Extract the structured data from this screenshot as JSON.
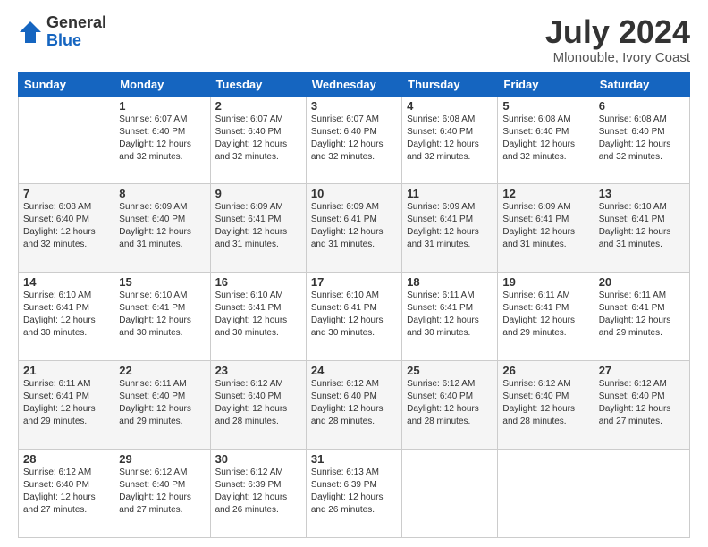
{
  "header": {
    "logo_general": "General",
    "logo_blue": "Blue",
    "title": "July 2024",
    "subtitle": "Mlonouble, Ivory Coast"
  },
  "days_of_week": [
    "Sunday",
    "Monday",
    "Tuesday",
    "Wednesday",
    "Thursday",
    "Friday",
    "Saturday"
  ],
  "weeks": [
    [
      {
        "day": "",
        "info": ""
      },
      {
        "day": "1",
        "info": "Sunrise: 6:07 AM\nSunset: 6:40 PM\nDaylight: 12 hours\nand 32 minutes."
      },
      {
        "day": "2",
        "info": "Sunrise: 6:07 AM\nSunset: 6:40 PM\nDaylight: 12 hours\nand 32 minutes."
      },
      {
        "day": "3",
        "info": "Sunrise: 6:07 AM\nSunset: 6:40 PM\nDaylight: 12 hours\nand 32 minutes."
      },
      {
        "day": "4",
        "info": "Sunrise: 6:08 AM\nSunset: 6:40 PM\nDaylight: 12 hours\nand 32 minutes."
      },
      {
        "day": "5",
        "info": "Sunrise: 6:08 AM\nSunset: 6:40 PM\nDaylight: 12 hours\nand 32 minutes."
      },
      {
        "day": "6",
        "info": "Sunrise: 6:08 AM\nSunset: 6:40 PM\nDaylight: 12 hours\nand 32 minutes."
      }
    ],
    [
      {
        "day": "7",
        "info": "Sunrise: 6:08 AM\nSunset: 6:40 PM\nDaylight: 12 hours\nand 32 minutes."
      },
      {
        "day": "8",
        "info": "Sunrise: 6:09 AM\nSunset: 6:40 PM\nDaylight: 12 hours\nand 31 minutes."
      },
      {
        "day": "9",
        "info": "Sunrise: 6:09 AM\nSunset: 6:41 PM\nDaylight: 12 hours\nand 31 minutes."
      },
      {
        "day": "10",
        "info": "Sunrise: 6:09 AM\nSunset: 6:41 PM\nDaylight: 12 hours\nand 31 minutes."
      },
      {
        "day": "11",
        "info": "Sunrise: 6:09 AM\nSunset: 6:41 PM\nDaylight: 12 hours\nand 31 minutes."
      },
      {
        "day": "12",
        "info": "Sunrise: 6:09 AM\nSunset: 6:41 PM\nDaylight: 12 hours\nand 31 minutes."
      },
      {
        "day": "13",
        "info": "Sunrise: 6:10 AM\nSunset: 6:41 PM\nDaylight: 12 hours\nand 31 minutes."
      }
    ],
    [
      {
        "day": "14",
        "info": "Sunrise: 6:10 AM\nSunset: 6:41 PM\nDaylight: 12 hours\nand 30 minutes."
      },
      {
        "day": "15",
        "info": "Sunrise: 6:10 AM\nSunset: 6:41 PM\nDaylight: 12 hours\nand 30 minutes."
      },
      {
        "day": "16",
        "info": "Sunrise: 6:10 AM\nSunset: 6:41 PM\nDaylight: 12 hours\nand 30 minutes."
      },
      {
        "day": "17",
        "info": "Sunrise: 6:10 AM\nSunset: 6:41 PM\nDaylight: 12 hours\nand 30 minutes."
      },
      {
        "day": "18",
        "info": "Sunrise: 6:11 AM\nSunset: 6:41 PM\nDaylight: 12 hours\nand 30 minutes."
      },
      {
        "day": "19",
        "info": "Sunrise: 6:11 AM\nSunset: 6:41 PM\nDaylight: 12 hours\nand 29 minutes."
      },
      {
        "day": "20",
        "info": "Sunrise: 6:11 AM\nSunset: 6:41 PM\nDaylight: 12 hours\nand 29 minutes."
      }
    ],
    [
      {
        "day": "21",
        "info": "Sunrise: 6:11 AM\nSunset: 6:41 PM\nDaylight: 12 hours\nand 29 minutes."
      },
      {
        "day": "22",
        "info": "Sunrise: 6:11 AM\nSunset: 6:40 PM\nDaylight: 12 hours\nand 29 minutes."
      },
      {
        "day": "23",
        "info": "Sunrise: 6:12 AM\nSunset: 6:40 PM\nDaylight: 12 hours\nand 28 minutes."
      },
      {
        "day": "24",
        "info": "Sunrise: 6:12 AM\nSunset: 6:40 PM\nDaylight: 12 hours\nand 28 minutes."
      },
      {
        "day": "25",
        "info": "Sunrise: 6:12 AM\nSunset: 6:40 PM\nDaylight: 12 hours\nand 28 minutes."
      },
      {
        "day": "26",
        "info": "Sunrise: 6:12 AM\nSunset: 6:40 PM\nDaylight: 12 hours\nand 28 minutes."
      },
      {
        "day": "27",
        "info": "Sunrise: 6:12 AM\nSunset: 6:40 PM\nDaylight: 12 hours\nand 27 minutes."
      }
    ],
    [
      {
        "day": "28",
        "info": "Sunrise: 6:12 AM\nSunset: 6:40 PM\nDaylight: 12 hours\nand 27 minutes."
      },
      {
        "day": "29",
        "info": "Sunrise: 6:12 AM\nSunset: 6:40 PM\nDaylight: 12 hours\nand 27 minutes."
      },
      {
        "day": "30",
        "info": "Sunrise: 6:12 AM\nSunset: 6:39 PM\nDaylight: 12 hours\nand 26 minutes."
      },
      {
        "day": "31",
        "info": "Sunrise: 6:13 AM\nSunset: 6:39 PM\nDaylight: 12 hours\nand 26 minutes."
      },
      {
        "day": "",
        "info": ""
      },
      {
        "day": "",
        "info": ""
      },
      {
        "day": "",
        "info": ""
      }
    ]
  ]
}
